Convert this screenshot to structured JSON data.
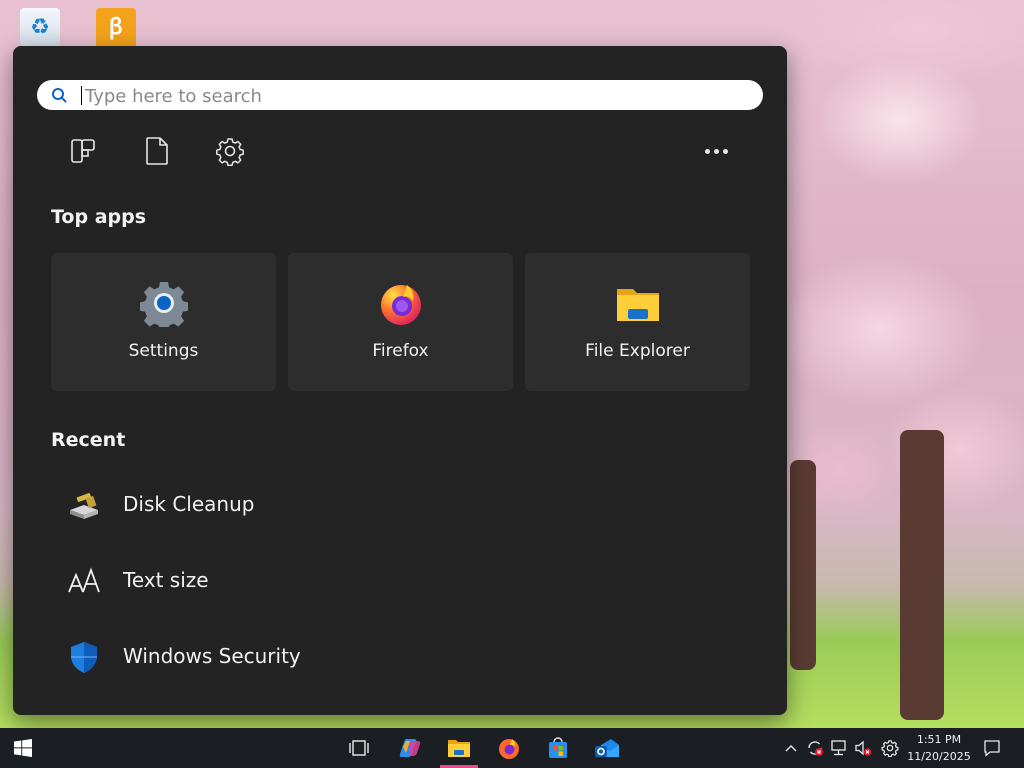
{
  "search": {
    "placeholder": "Type here to search"
  },
  "quick_actions": {
    "icons": [
      "apps-grid-icon",
      "document-icon",
      "gear-icon"
    ],
    "more": "ellipsis-icon"
  },
  "top_apps": {
    "title": "Top apps",
    "items": [
      {
        "label": "Settings",
        "icon": "settings-gear-icon"
      },
      {
        "label": "Firefox",
        "icon": "firefox-icon"
      },
      {
        "label": "File Explorer",
        "icon": "folder-icon"
      }
    ]
  },
  "recent": {
    "title": "Recent",
    "items": [
      {
        "label": "Disk Cleanup",
        "icon": "disk-cleanup-icon"
      },
      {
        "label": "Text size",
        "icon": "text-size-icon"
      },
      {
        "label": "Windows Security",
        "icon": "shield-icon"
      }
    ]
  },
  "taskbar": {
    "apps": [
      "windows-start-icon",
      "task-view-icon",
      "copilot-icon",
      "file-explorer-icon",
      "firefox-icon",
      "microsoft-store-icon",
      "outlook-icon"
    ],
    "tray": [
      "chevron-up-icon",
      "sync-error-icon",
      "network-icon",
      "volume-muted-icon",
      "settings-icon"
    ],
    "time": "1:51 PM",
    "date": "11/20/2025",
    "notifications_icon": "notification-icon"
  },
  "colors": {
    "menu_bg": "#232323",
    "tile_bg": "#2d2d2d",
    "accent": "#0a64c8",
    "taskbar_bg": "#1b1f24"
  }
}
